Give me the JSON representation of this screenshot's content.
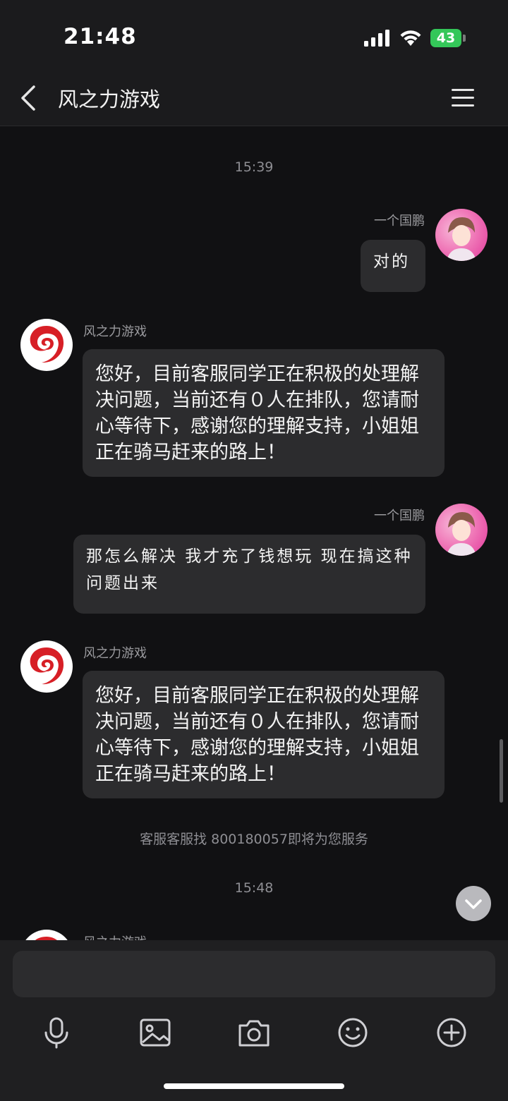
{
  "status_bar": {
    "time": "21:48",
    "battery": "43"
  },
  "header": {
    "title": "风之力游戏"
  },
  "chat": {
    "timestamp_1": "15:39",
    "msg1": {
      "sender": "一个国鹏",
      "text": "对的"
    },
    "msg2": {
      "sender": "风之力游戏",
      "text": "您好，目前客服同学正在积极的处理解决问题，当前还有０人在排队，您请耐心等待下，感谢您的理解支持，小姐姐正在骑马赶来的路上！"
    },
    "msg3": {
      "sender": "一个国鹏",
      "text": "那怎么解决 我才充了钱想玩 现在搞这种问题出来"
    },
    "msg4": {
      "sender": "风之力游戏",
      "text": "您好，目前客服同学正在积极的处理解决问题，当前还有０人在排队，您请耐心等待下，感谢您的理解支持，小姐姐正在骑马赶来的路上！"
    },
    "notice": "客服客服找 800180057即将为您服务",
    "timestamp_2": "15:48",
    "msg5": {
      "sender": "风之力游戏"
    }
  },
  "toolbar": {
    "icons": [
      "microphone-icon",
      "image-icon",
      "camera-icon",
      "emoji-icon",
      "plus-icon"
    ]
  },
  "colors": {
    "background": "#111113",
    "bubble": "#2c2c2e",
    "battery": "#34c759",
    "brand": "#d71f26"
  }
}
